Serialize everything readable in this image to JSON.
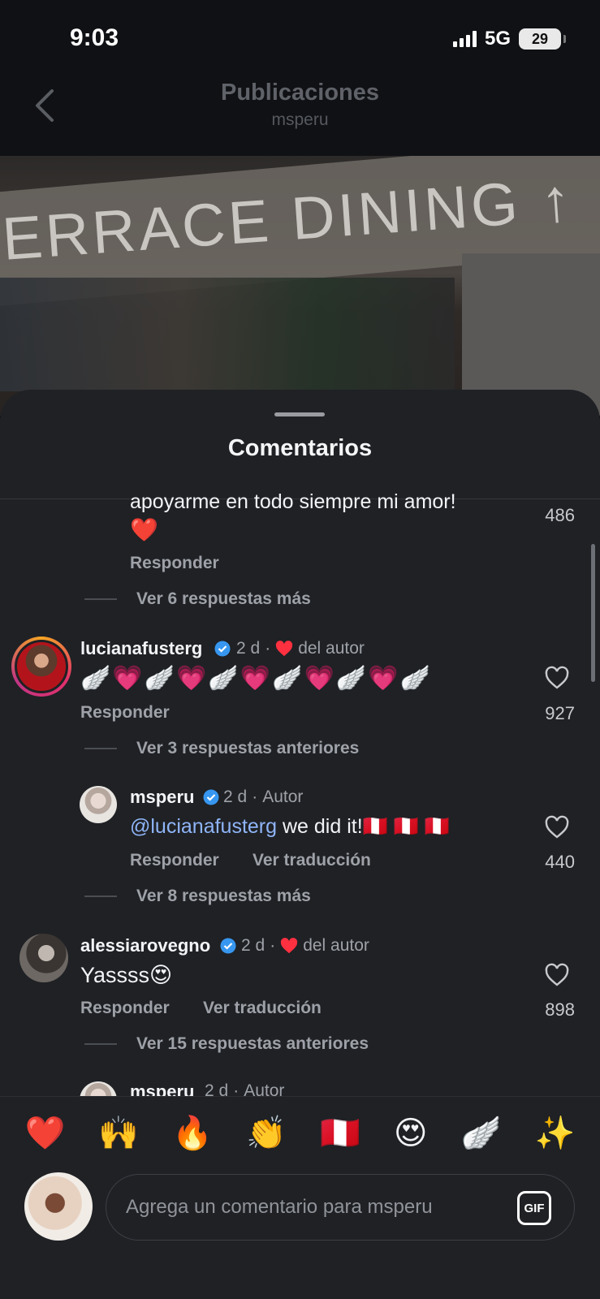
{
  "status": {
    "time": "9:03",
    "network": "5G",
    "battery": "29"
  },
  "header": {
    "title": "Publicaciones",
    "subtitle": "msperu"
  },
  "photo": {
    "sign_text": "ERRACE DINING ↑"
  },
  "sheet": {
    "title": "Comentarios"
  },
  "comments": [
    {
      "text_line1": "apoyarme en todo siempre mi amor!",
      "text_line2": "❤️",
      "reply_label": "Responder",
      "likes": "486",
      "more_replies": "Ver 6 respuestas más"
    },
    {
      "username": "lucianafusterg",
      "time": "2 d",
      "separator": "·",
      "author_like": "del autor",
      "text": "🪽💗🪽💗🪽💗🪽💗🪽💗🪽",
      "reply_label": "Responder",
      "likes": "927",
      "more_replies": "Ver 3 respuestas anteriores"
    },
    {
      "username": "msperu",
      "time": "2 d",
      "separator": "·",
      "badge": "Autor",
      "mention": "@lucianafusterg",
      "text": " we did it!🇵🇪 🇵🇪 🇵🇪",
      "reply_label": "Responder",
      "translate_label": "Ver traducción",
      "likes": "440",
      "more_replies": "Ver 8 respuestas más"
    },
    {
      "username": "alessiarovegno",
      "time": "2 d",
      "separator": "·",
      "author_like": "del autor",
      "text": "Yassss😍",
      "reply_label": "Responder",
      "translate_label": "Ver traducción",
      "likes": "898",
      "more_replies": "Ver 15 respuestas anteriores"
    },
    {
      "username": "msperu",
      "time": "2 d",
      "separator": "·",
      "badge": "Autor"
    }
  ],
  "emoji_bar": [
    "❤️",
    "🙌",
    "🔥",
    "👏",
    "🇵🇪",
    "😍",
    "🪽",
    "✨"
  ],
  "composer": {
    "placeholder": "Agrega un comentario para msperu",
    "gif_label": "GIF"
  },
  "colors": {
    "sheet_bg": "#1f2125",
    "mention": "#8fb5f7",
    "verified": "#3797f0",
    "heart": "#ff3040"
  }
}
